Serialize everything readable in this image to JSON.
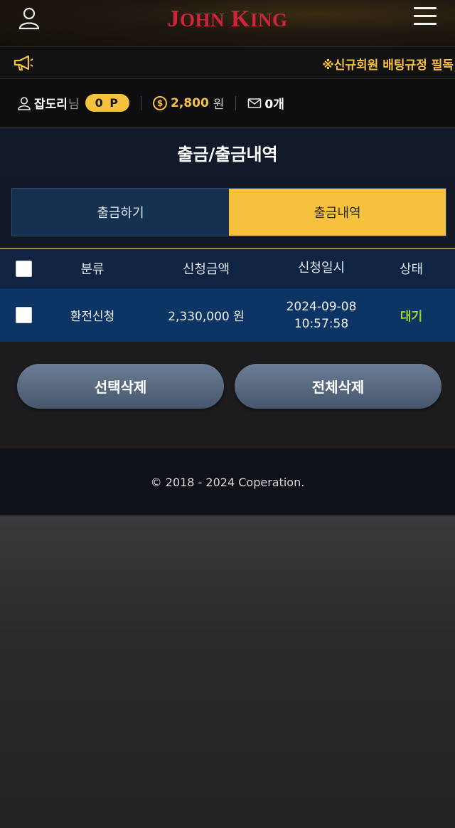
{
  "header": {
    "logo_first": "J",
    "logo_first_rest": "OHN",
    "logo_second": "K",
    "logo_second_rest": "ING",
    "user_icon": "user-icon",
    "menu_icon": "hamburger-menu-icon"
  },
  "notice": {
    "icon": "megaphone-icon",
    "text": "※신규회원 배팅규정 필독"
  },
  "userinfo": {
    "username": "잡도리",
    "suffix": "님",
    "points": "0 P",
    "coin_symbol": "$",
    "money": "2,800",
    "money_unit": "원",
    "messages": "0개"
  },
  "page": {
    "title": "출금/출금내역"
  },
  "tabs": [
    {
      "label": "출금하기",
      "active": false
    },
    {
      "label": "출금내역",
      "active": true
    }
  ],
  "table": {
    "headers": {
      "type": "분류",
      "amount": "신청금액",
      "date": "신청일시",
      "status": "상태"
    },
    "rows": [
      {
        "type": "환전신청",
        "amount": "2,330,000 원",
        "date": "2024-09-08",
        "time": "10:57:58",
        "status": "대기"
      }
    ]
  },
  "buttons": {
    "delete_selected": "선택삭제",
    "delete_all": "전체삭제"
  },
  "footer": {
    "copyright": "© 2018 - 2024 Coperation."
  },
  "colors": {
    "accent": "#f6c23e",
    "logo_red": "#d1243a",
    "status_wait": "#9fd330",
    "row_blue": "#0c3566"
  }
}
